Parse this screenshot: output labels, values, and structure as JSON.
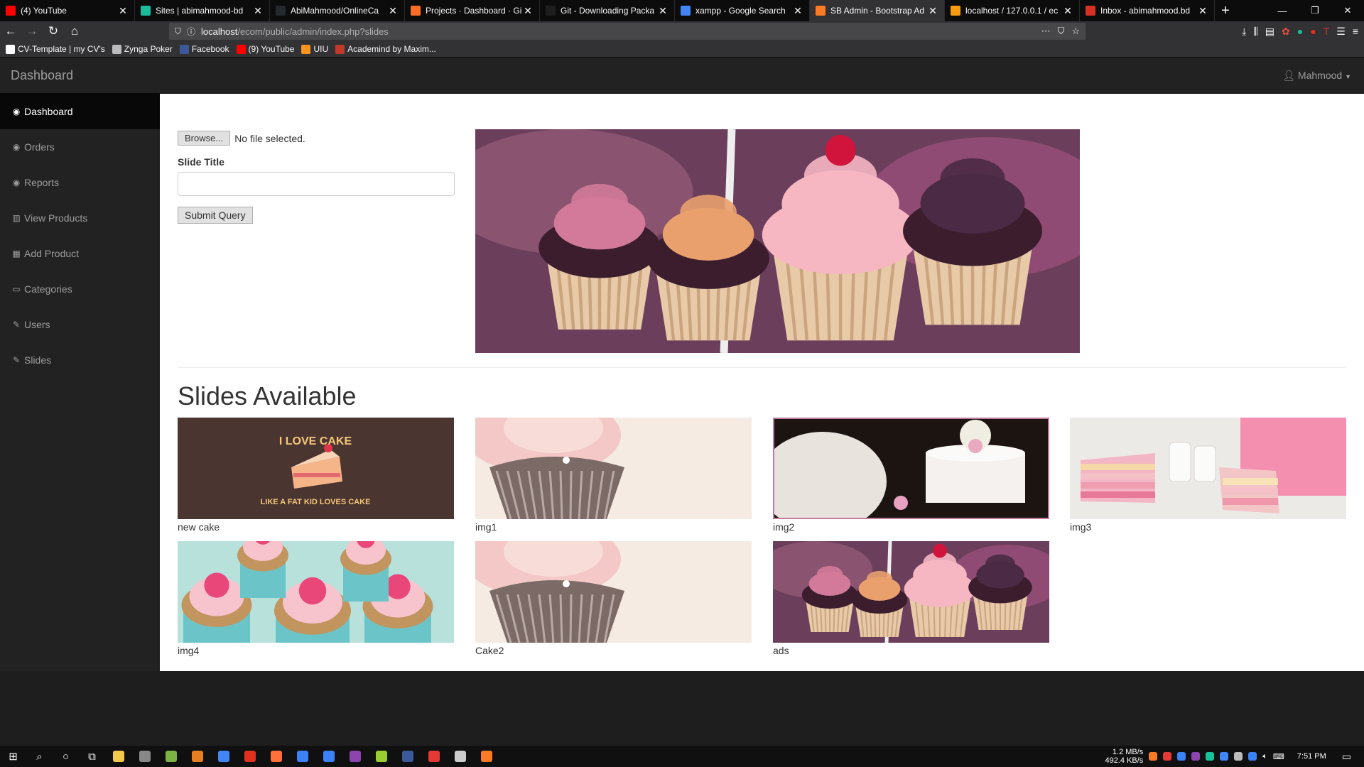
{
  "browser": {
    "tabs": [
      {
        "title": "(4) YouTube",
        "icon": "youtube-icon",
        "color": "#ff0000"
      },
      {
        "title": "Sites | abimahmood-bd",
        "icon": "sites-icon",
        "color": "#1abc9c"
      },
      {
        "title": "AbiMahmood/OnlineCa",
        "icon": "github-icon",
        "color": "#24292e"
      },
      {
        "title": "Projects · Dashboard · Gi",
        "icon": "gitlab-icon",
        "color": "#fc6d26"
      },
      {
        "title": "Git - Downloading Packa",
        "icon": "git-icon",
        "color": "#1e1e1e"
      },
      {
        "title": "xampp - Google Search",
        "icon": "google-icon",
        "color": "#4285f4"
      },
      {
        "title": "SB Admin - Bootstrap Ad",
        "icon": "xampp-icon",
        "color": "#fb7a24"
      },
      {
        "title": "localhost / 127.0.0.1 / ec",
        "icon": "phpmyadmin-icon",
        "color": "#f89c0e"
      },
      {
        "title": "Inbox - abimahmood.bd",
        "icon": "gmail-icon",
        "color": "#d93025"
      }
    ],
    "active_tab": 6,
    "url_host": "localhost",
    "url_path": "/ecom/public/admin/index.php?slides",
    "bookmarks": [
      {
        "label": "CV-Template | my CV's",
        "color": "#ffffff"
      },
      {
        "label": "Zynga Poker",
        "color": "#bbbbbb"
      },
      {
        "label": "Facebook",
        "color": "#3b5998"
      },
      {
        "label": "(9) YouTube",
        "color": "#ff0000"
      },
      {
        "label": "UIU",
        "color": "#f7941d"
      },
      {
        "label": "Academind by Maxim...",
        "color": "#c0392b"
      }
    ]
  },
  "app": {
    "brand": "Dashboard",
    "user": "Mahmood",
    "sidebar": [
      {
        "label": "Dashboard",
        "icon": "dashboard-icon",
        "glyph": "◉"
      },
      {
        "label": "Orders",
        "icon": "orders-icon",
        "glyph": "◉"
      },
      {
        "label": "Reports",
        "icon": "reports-icon",
        "glyph": "◉"
      },
      {
        "label": "View Products",
        "icon": "bar-chart-icon",
        "glyph": "▥"
      },
      {
        "label": "Add Product",
        "icon": "table-icon",
        "glyph": "▦"
      },
      {
        "label": "Categories",
        "icon": "desktop-icon",
        "glyph": "▭"
      },
      {
        "label": "Users",
        "icon": "wrench-icon",
        "glyph": "✎"
      },
      {
        "label": "Slides",
        "icon": "wrench-icon",
        "glyph": "✎"
      }
    ],
    "active_sidebar": 0
  },
  "form": {
    "browse_label": "Browse...",
    "file_status": "No file selected.",
    "slide_title_label": "Slide Title",
    "slide_title_value": "",
    "submit_label": "Submit Query"
  },
  "slides_heading": "Slides Available",
  "slides": [
    {
      "caption": "new cake",
      "kind": "love-cake",
      "text1": "I LOVE CAKE",
      "text2": "LIKE A FAT KID LOVES CAKE"
    },
    {
      "caption": "img1",
      "kind": "cupcake-cream"
    },
    {
      "caption": "img2",
      "kind": "wedding-cake",
      "selected": true
    },
    {
      "caption": "img3",
      "kind": "pink-layer-cake"
    },
    {
      "caption": "img4",
      "kind": "rose-cupcakes"
    },
    {
      "caption": "Cake2",
      "kind": "cupcake-cream"
    },
    {
      "caption": "ads",
      "kind": "cupcakes-stand"
    }
  ],
  "taskbar": {
    "net_up": "1.2 MB/s",
    "net_down": "492.4 KB/s",
    "time": "7:51 PM"
  }
}
